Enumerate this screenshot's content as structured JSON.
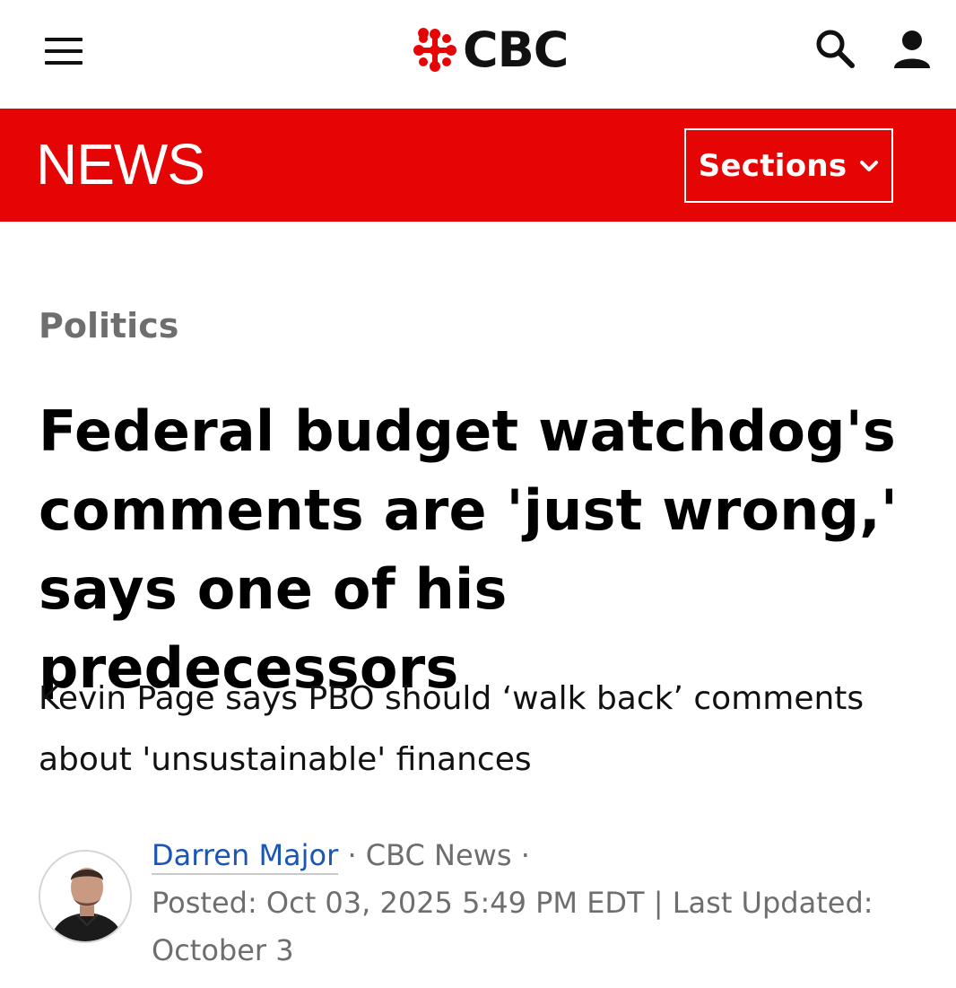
{
  "header": {
    "logo_text": "CBC",
    "brand_color": "#e60505"
  },
  "newsbar": {
    "title": "NEWS",
    "sections_label": "Sections"
  },
  "article": {
    "category": "Politics",
    "headline": "Federal budget watchdog's comments are 'just wrong,' says one of his predecessors",
    "deck": "Kevin Page says PBO should ‘walk back’ comments about 'unsustainable' finances",
    "author": "Darren Major",
    "separator1": " · ",
    "outlet": "CBC News",
    "separator2": " · ",
    "posted": "Posted: Oct 03, 2025 5:49 PM EDT | Last Updated: October 3"
  },
  "icons": {
    "menu": "hamburger-icon",
    "search": "search-icon",
    "user": "user-icon",
    "chevron": "chevron-down-icon",
    "logo": "cbc-gem-logo"
  },
  "colors": {
    "author_link": "#1a56b5",
    "meta_text": "#6e6e6e"
  }
}
